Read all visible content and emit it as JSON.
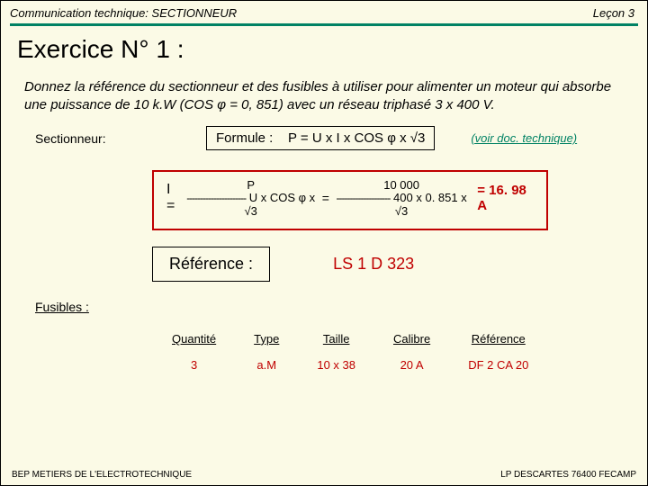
{
  "header": {
    "left": "Communication technique: SECTIONNEUR",
    "right": "Leçon 3"
  },
  "title": "Exercice N° 1 :",
  "instruction": "Donnez la référence du sectionneur et des fusibles à utiliser pour alimenter un moteur qui absorbe une puissance de 10 k.W (COS φ = 0, 851) avec un réseau triphasé 3 x 400 V.",
  "sectionneur_label": "Sectionneur:",
  "formula": {
    "label": "Formule :",
    "expr": "P = U x I x COS φ x √3"
  },
  "doc_link": "(voir doc. technique)",
  "calc": {
    "lhs_prefix": "I =",
    "lhs_top": "P",
    "lhs_dash": "----------------------",
    "lhs_bot": "U x COS φ x √3",
    "mid": "=",
    "rhs_top": "10 000",
    "rhs_dash": "--------------------",
    "rhs_bot": "400 x 0. 851 x √3",
    "result": "= 16. 98 A"
  },
  "reference": {
    "label": "Référence :",
    "value": "LS 1 D 323"
  },
  "fusibles_label": "Fusibles :",
  "table": {
    "heads": {
      "qty": "Quantité",
      "type": "Type",
      "size": "Taille",
      "cal": "Calibre",
      "ref": "Référence"
    },
    "row": {
      "qty": "3",
      "type": "a.M",
      "size": "10 x 38",
      "cal": "20 A",
      "ref": "DF 2 CA 20"
    }
  },
  "footer": {
    "left": "BEP METIERS DE L'ELECTROTECHNIQUE",
    "right": "LP DESCARTES 76400 FECAMP"
  }
}
